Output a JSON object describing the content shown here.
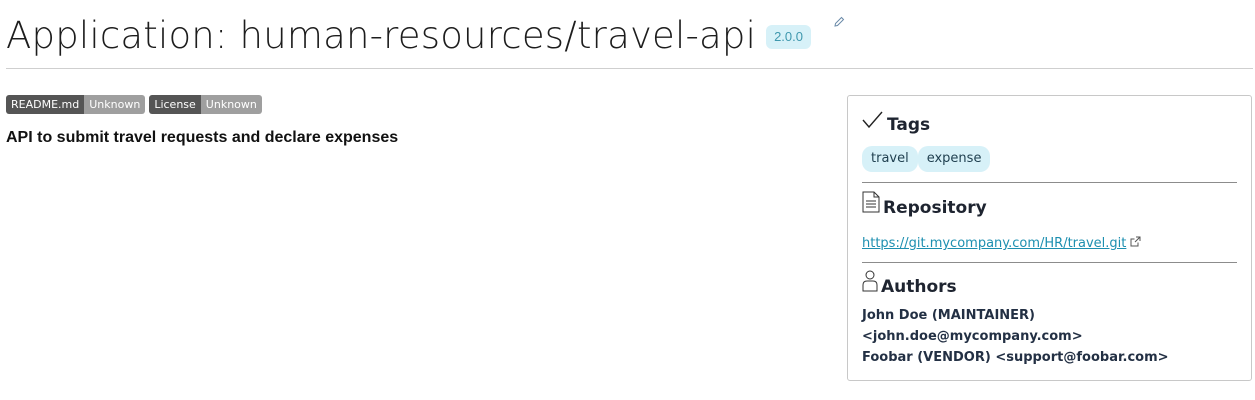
{
  "header": {
    "title": "Application: human-resources/travel-api",
    "version": "2.0.0",
    "edit_icon": "pencil-icon"
  },
  "shields": [
    {
      "label": "README.md",
      "value": "Unknown"
    },
    {
      "label": "License",
      "value": "Unknown"
    }
  ],
  "description": "API to submit travel requests and declare expenses",
  "sidebar": {
    "tags": {
      "title": "Tags",
      "icon": "check-icon",
      "items": [
        "travel",
        "expense"
      ]
    },
    "repository": {
      "title": "Repository",
      "icon": "document-icon",
      "url": "https://git.mycompany.com/HR/travel.git",
      "link_icon": "external-link-icon"
    },
    "authors": {
      "title": "Authors",
      "icon": "user-icon",
      "lines": [
        "John Doe (MAINTAINER)",
        "<john.doe@mycompany.com>",
        "Foobar (VENDOR) <support@foobar.com>"
      ]
    }
  },
  "colors": {
    "accent": "#1d8fb0",
    "tag_bg": "#d7f1f8",
    "shield_left": "#555555",
    "shield_right": "#9f9f9f"
  }
}
